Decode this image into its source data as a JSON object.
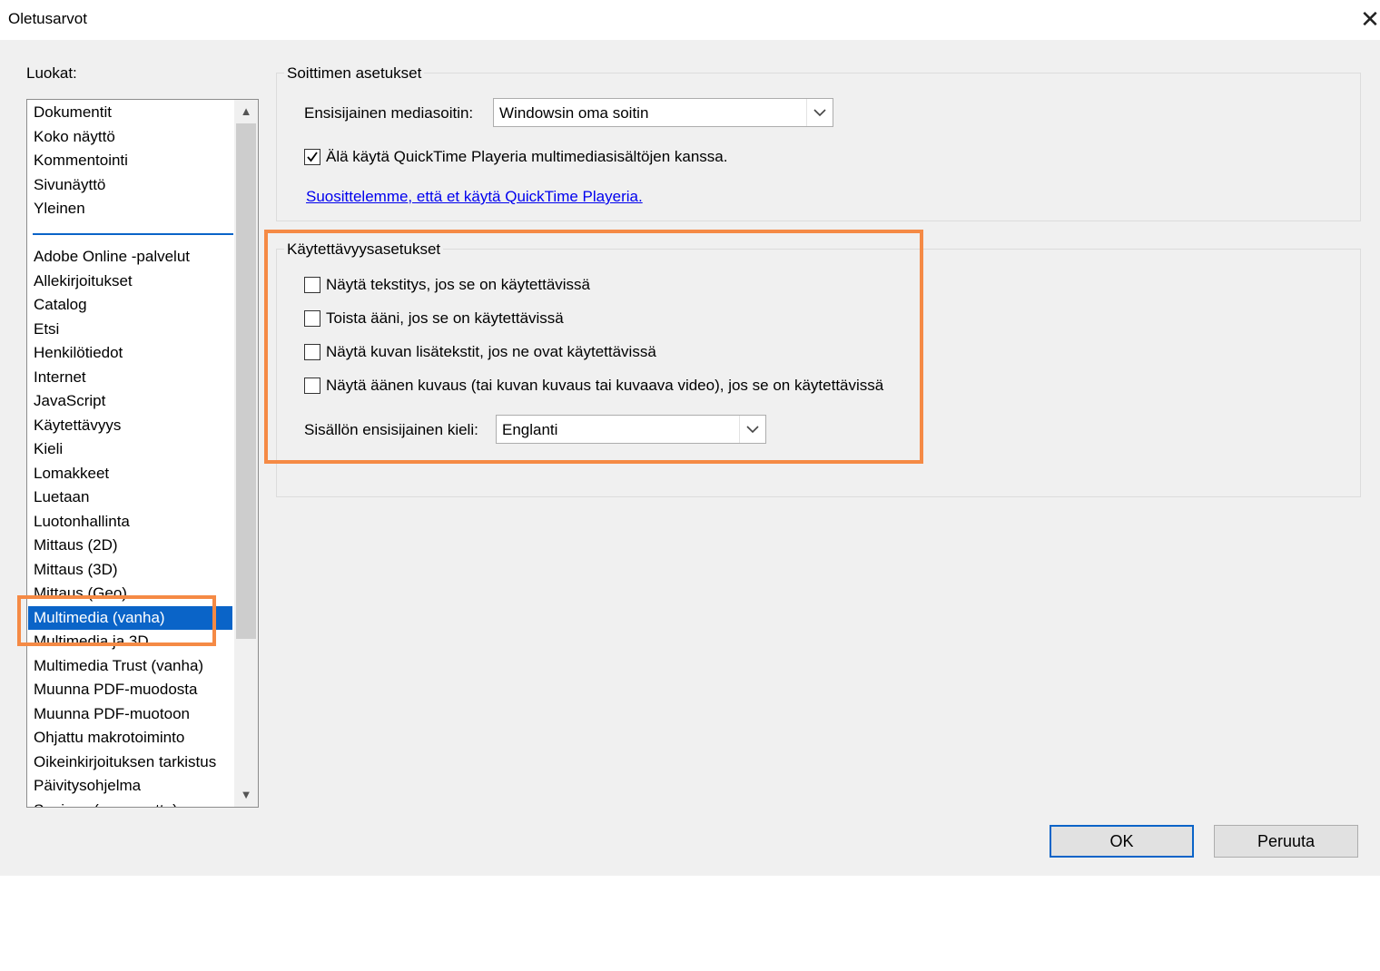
{
  "window": {
    "title": "Oletusarvot",
    "close_icon": "close-icon"
  },
  "categories": {
    "label": "Luokat:",
    "items": [
      "Dokumentit",
      "Koko näyttö",
      "Kommentointi",
      "Sivunäyttö",
      "Yleinen",
      "Adobe Online -palvelut",
      "Allekirjoitukset",
      "Catalog",
      "Etsi",
      "Henkilötiedot",
      "Internet",
      "JavaScript",
      "Käytettävyys",
      "Kieli",
      "Lomakkeet",
      "Luetaan",
      "Luotonhallinta",
      "Mittaus (2D)",
      "Mittaus (3D)",
      "Mittaus (Geo)",
      "Multimedia (vanha)",
      "Multimedia ja 3D",
      "Multimedia Trust (vanha)",
      "Muunna PDF-muodosta",
      "Muunna PDF-muotoon",
      "Ohjattu makrotoiminto",
      "Oikeinkirjoituksen tarkistus",
      "Päivitysohjelma",
      "Suojaus (parannettu)"
    ],
    "selected": "Multimedia (vanha)"
  },
  "player_settings": {
    "title": "Soittimen asetukset",
    "media_player_label": "Ensisijainen mediasoitin:",
    "media_player_value": "Windowsin oma soitin",
    "quicktime_checkbox_label": "Älä käytä QuickTime Playeria multimediasisältöjen kanssa.",
    "quicktime_checked": true,
    "recommendation_link": "Suosittelemme, että et käytä QuickTime Playeria."
  },
  "accessibility_settings": {
    "title": "Käytettävyysasetukset",
    "options": [
      {
        "label": "Näytä tekstitys, jos se on käytettävissä",
        "checked": false
      },
      {
        "label": "Toista ääni, jos se on käytettävissä",
        "checked": false
      },
      {
        "label": "Näytä kuvan lisätekstit, jos ne ovat käytettävissä",
        "checked": false
      },
      {
        "label": "Näytä äänen kuvaus (tai kuvan kuvaus tai kuvaava video), jos se on käytettävissä",
        "checked": false
      }
    ],
    "language_label": "Sisällön ensisijainen kieli:",
    "language_value": "Englanti"
  },
  "buttons": {
    "ok": "OK",
    "cancel": "Peruuta"
  },
  "colors": {
    "highlight": "#f58a45",
    "selection": "#0a64c8",
    "link": "#0000ee"
  }
}
